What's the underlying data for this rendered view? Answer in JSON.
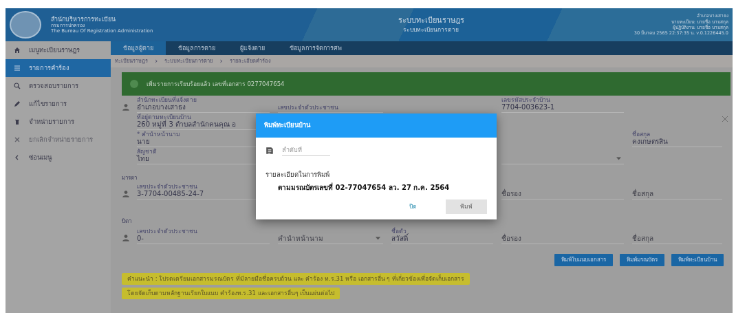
{
  "header": {
    "org_name": "สำนักบริหารการทะเบียน",
    "org_sub": "กรมการปกครอง",
    "org_en": "The Bureau Of Registration Administration",
    "system_title": "ระบบทะเบียนราษฎร",
    "system_subtitle": "ระบบทะเบียนการตาย",
    "user_lines": [
      "อำเภอบางเสาธง",
      "นายทะเบียน: นายชื่อ นามสกุล",
      "ผู้ปฏิบัติงาน: นายชื่อ นามสกุล",
      "30 มีนาคม 2565 22:37:35 น. v.0.1226445.0"
    ]
  },
  "sidebar": {
    "items": [
      {
        "label": "เมนูทะเบียนราษฎร",
        "selected": false,
        "disabled": false
      },
      {
        "label": "รายการคำร้อง",
        "selected": true,
        "disabled": false
      },
      {
        "label": "ตรวจสอบรายการ",
        "selected": false,
        "disabled": false
      },
      {
        "label": "แก้ไขรายการ",
        "selected": false,
        "disabled": false
      },
      {
        "label": "จำหน่ายรายการ",
        "selected": false,
        "disabled": false
      },
      {
        "label": "ยกเลิกจำหน่ายรายการ",
        "selected": false,
        "disabled": true
      },
      {
        "label": "ซ่อนเมนู",
        "selected": false,
        "disabled": false
      }
    ]
  },
  "tabs": [
    {
      "label": "ข้อมูลผู้ตาย",
      "selected": true
    },
    {
      "label": "ข้อมูลการตาย",
      "selected": false
    },
    {
      "label": "ผู้แจ้งตาย",
      "selected": false
    },
    {
      "label": "ข้อมูลการจัดการศพ",
      "selected": false
    }
  ],
  "breadcrumb": [
    "ทะเบียนราษฎร",
    "ระบบทะเบียนการตาย",
    "รายละเอียดคำร้อง"
  ],
  "breadcrumb_separator": "›",
  "alert": {
    "text": "เพิ่มรายการเรียบร้อยแล้ว เลขที่เอกสาร 0277047654"
  },
  "sections": [
    {
      "rows": [
        {
          "person": true,
          "fields": [
            {
              "kind": "office",
              "label": "สำนักทะเบียนที่แจ้งตาย",
              "value": "อำเภอบางเสาธง"
            },
            {
              "kind": "id",
              "label": "เลขประจำตัวประชาชน"
            },
            {
              "kind": "house_code",
              "label": "เลขรหัสประจำบ้าน",
              "value": "7704-003623-1"
            }
          ]
        },
        {
          "person": false,
          "fields": [
            {
              "kind": "address",
              "label": "ที่อยู่ตามทะเบียนบ้าน",
              "value": "260 หมู่ที่ 3 ตำบลสำนักคนคุณ อ"
            }
          ]
        },
        {
          "person": false,
          "fields": [
            {
              "kind": "prefix",
              "label": "* คำนำหน้านาม",
              "value": "นาย"
            },
            {
              "kind": "surname",
              "label": "ชื่อสกุล",
              "value": "คงเกษตรสิน"
            }
          ]
        },
        {
          "person": false,
          "fields": [
            {
              "kind": "nationality",
              "label": "สัญชาติ",
              "value": "ไทย"
            },
            {
              "kind": "unlabeled",
              "dropdown": true
            }
          ]
        }
      ]
    },
    {
      "title": "มารดา",
      "rows": [
        {
          "person": true,
          "fields": [
            {
              "kind": "id",
              "label": "เลขประจำตัวประชาชน",
              "value": "3-7704-00485-24-7"
            },
            {
              "kind": "middle_name",
              "placeholder": "ชื่อรอง"
            },
            {
              "kind": "surname",
              "placeholder": "ชื่อสกุล"
            }
          ]
        }
      ]
    },
    {
      "title": "บิดา",
      "rows": [
        {
          "person": true,
          "fields": [
            {
              "kind": "id",
              "label": "เลขประจำตัวประชาชน",
              "value": "0-"
            },
            {
              "kind": "prefix",
              "placeholder": "คำนำหน้านาม",
              "dropdown": true
            },
            {
              "kind": "first_name",
              "label": "ชื่อตัว",
              "value": "สวัสดิ์"
            },
            {
              "kind": "middle_name",
              "placeholder": "ชื่อรอง"
            },
            {
              "kind": "surname",
              "placeholder": "ชื่อสกุล"
            }
          ]
        }
      ]
    }
  ],
  "actions": [
    "พิมพ์ใบแนบเอกสาร",
    "พิมพ์มรณบัตร",
    "พิมพ์ทะเบียนบ้าน"
  ],
  "notes": [
    "คำแนะนำ : โปรดเตรียมเอกสารมรณบัตร ที่มีลายมือชื่อครบถ้วน และ คำร้อง ท.ร.31 หรือ เอกสารอื่น ๆ ที่เกี่ยวข้องเพื่อจัดเก็บเอกสาร",
    "โดยจัดเก็บตามหลักฐานเรียกใบแนบ คำร้องท.ร.31 และเอกสารอื่นๆ เป็นแผ่นต่อไป"
  ],
  "dialog": {
    "title": "พิมพ์ทะเบียนบ้าน",
    "field": {
      "placeholder": "ลำดับที่"
    },
    "detail_label": "รายละเอียดในการพิมพ์",
    "detail": "ตามมรณบัตรเลขที่ 02-77047654 ลว. 27 ก.ค. 2564",
    "buttons": [
      {
        "label": "ปิด",
        "disabled": false
      },
      {
        "label": "พิมพ์",
        "disabled": true
      }
    ]
  }
}
